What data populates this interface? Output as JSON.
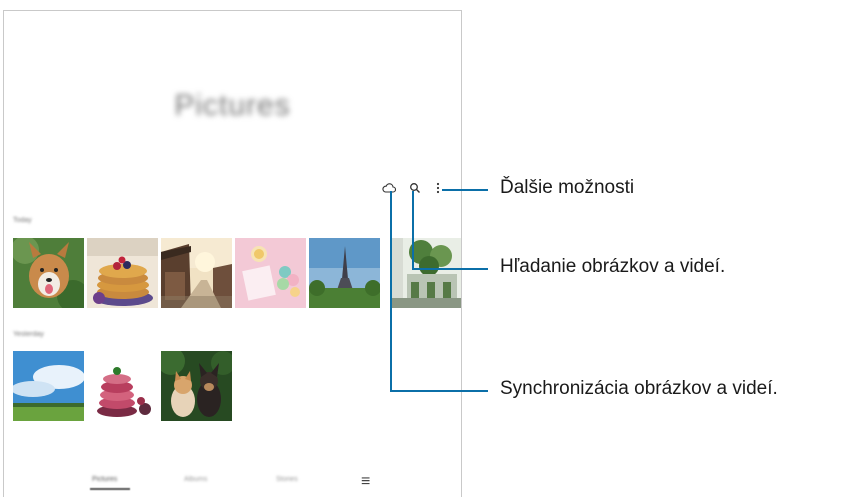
{
  "app": {
    "title": "Pictures",
    "toolbar": {
      "cloud_icon": "cloud-icon",
      "search_icon": "search-icon",
      "more_icon": "more-options-icon"
    },
    "sections": [
      {
        "label": "Today"
      },
      {
        "label": "Yesterday"
      }
    ],
    "bottom_nav": {
      "tabs": [
        "Pictures",
        "Albums",
        "Stories"
      ],
      "menu_icon": "menu-icon",
      "menu_glyph": "≡"
    }
  },
  "callouts": {
    "more": "Ďalšie možnosti",
    "search": "Hľadanie obrázkov a videí.",
    "sync": "Synchronizácia obrázkov a videí."
  },
  "colors": {
    "callout_line": "#0b6fa8"
  }
}
